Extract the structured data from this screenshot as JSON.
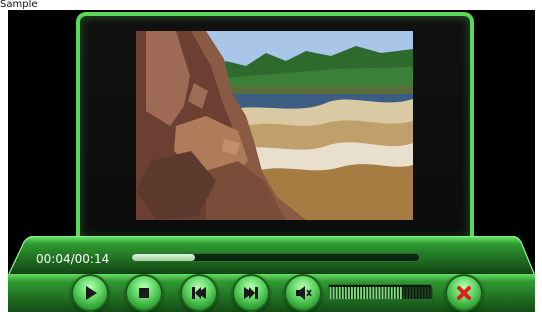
{
  "window": {
    "title": "Sample"
  },
  "player": {
    "time_display": "00:04/00:14",
    "progress_fraction": 0.22,
    "volume_fraction": 0.72
  },
  "controls": {
    "buttons": [
      {
        "name": "play-button",
        "icon": "play-icon"
      },
      {
        "name": "stop-button",
        "icon": "stop-icon"
      },
      {
        "name": "previous-button",
        "icon": "previous-track-icon"
      },
      {
        "name": "next-button",
        "icon": "next-track-icon"
      },
      {
        "name": "mute-button",
        "icon": "speaker-mute-icon"
      },
      {
        "name": "close-button",
        "icon": "close-icon"
      }
    ]
  },
  "colors": {
    "accent_green": "#59d85a",
    "panel_green_dark": "#1b5b1d",
    "close_red": "#e02020"
  }
}
